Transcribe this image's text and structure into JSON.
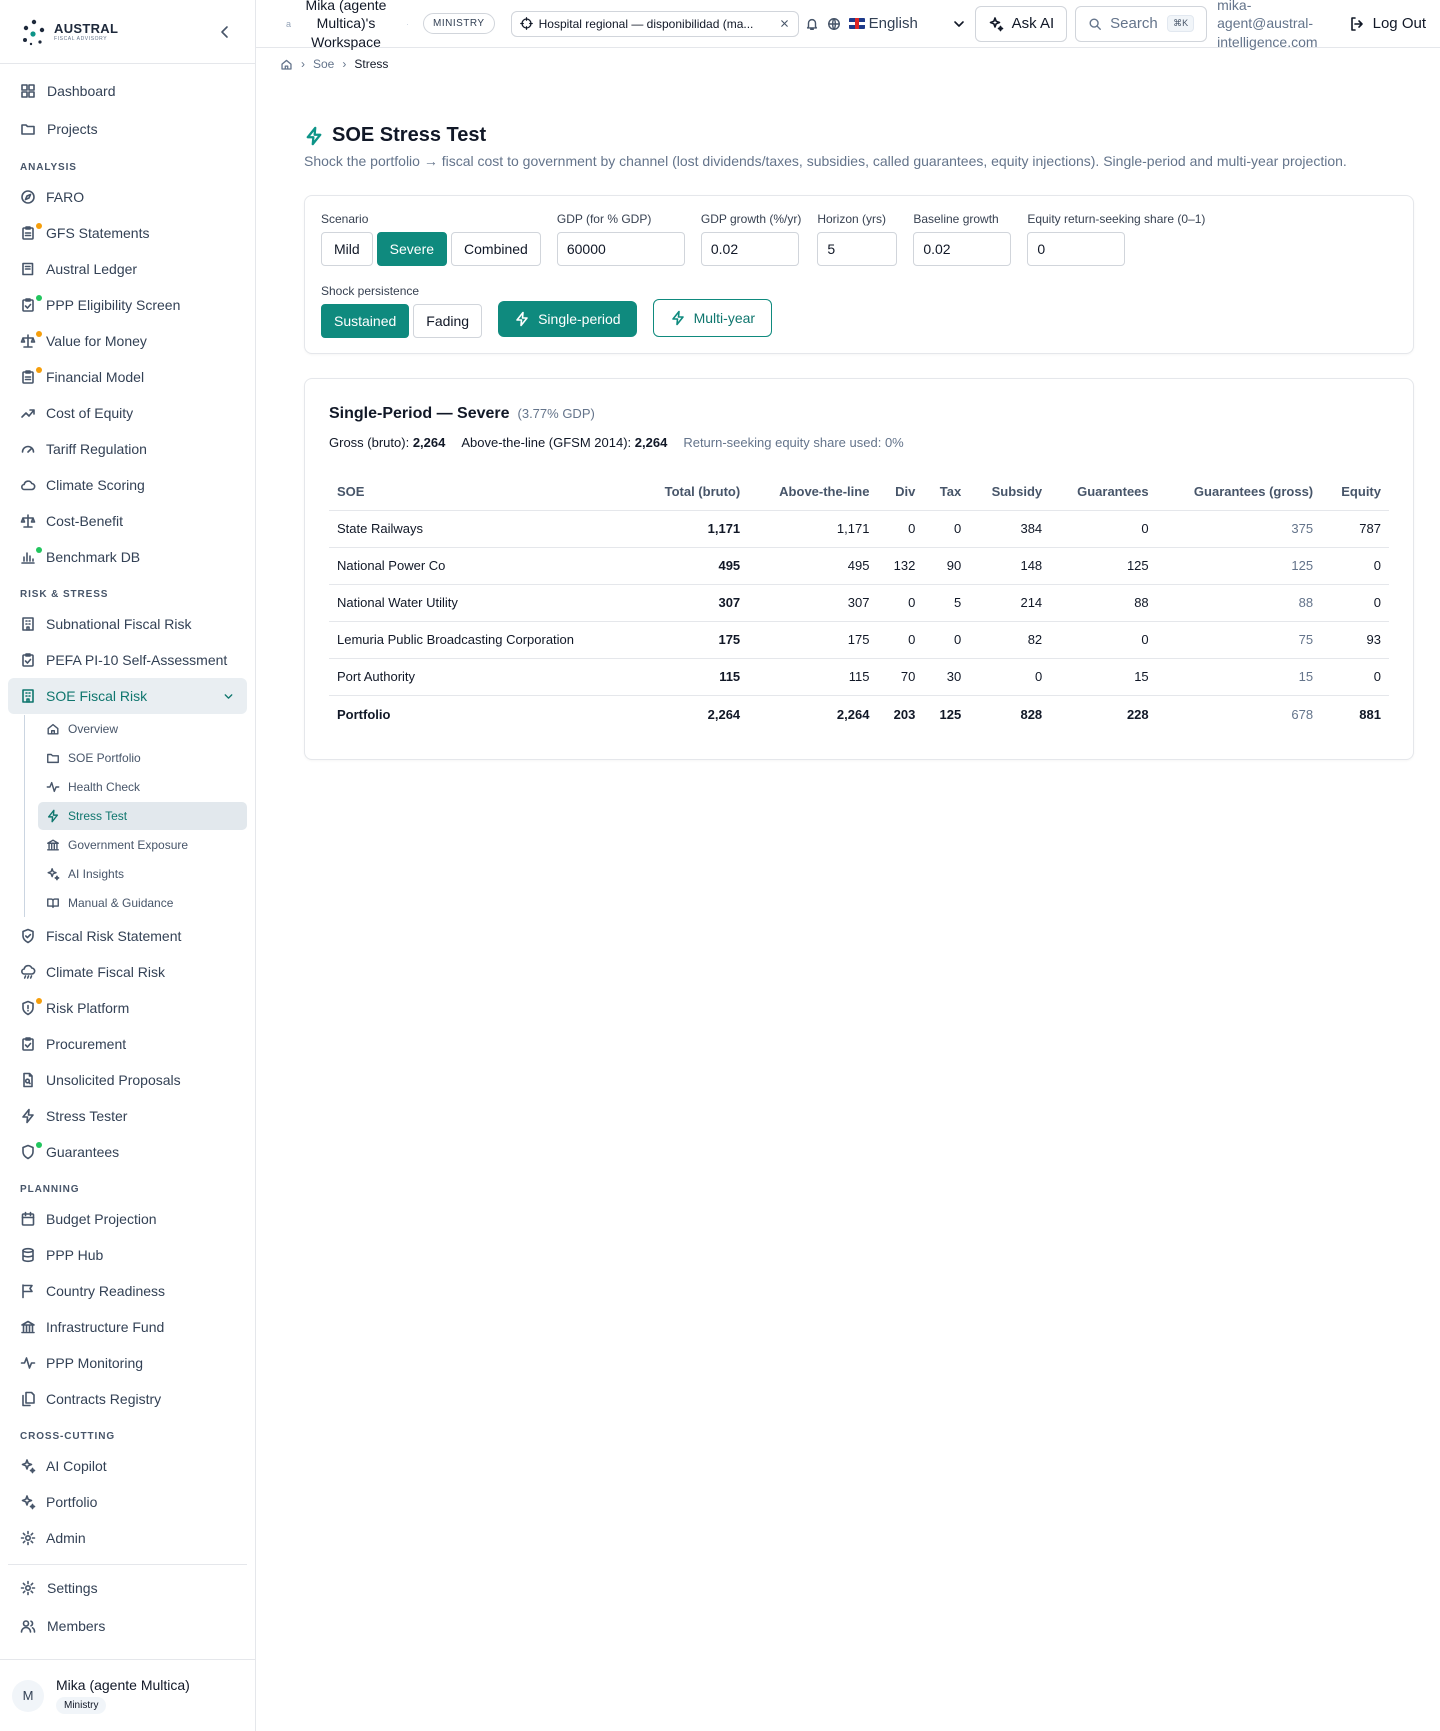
{
  "brand": {
    "name": "AUSTRAL",
    "sub": "FISCAL ADVISORY"
  },
  "colors": {
    "accent": "#0f8a7e",
    "dot_orange": "#f59e0b",
    "dot_green": "#22c55e"
  },
  "sidebar": {
    "top_items": [
      {
        "label": "Dashboard",
        "icon": "grid-icon"
      },
      {
        "label": "Projects",
        "icon": "folder-icon"
      }
    ],
    "sections": [
      {
        "title": "ANALYSIS",
        "items": [
          {
            "label": "FARO",
            "icon": "compass-icon"
          },
          {
            "label": "GFS Statements",
            "icon": "clipboard-icon",
            "dot": "orange"
          },
          {
            "label": "Austral Ledger",
            "icon": "book-icon"
          },
          {
            "label": "PPP Eligibility Screen",
            "icon": "clipboard-check-icon",
            "dot": "green"
          },
          {
            "label": "Value for Money",
            "icon": "scale-icon",
            "dot": "orange"
          },
          {
            "label": "Financial Model",
            "icon": "clipboard-icon",
            "dot": "orange"
          },
          {
            "label": "Cost of Equity",
            "icon": "trending-up-icon"
          },
          {
            "label": "Tariff Regulation",
            "icon": "gauge-icon"
          },
          {
            "label": "Climate Scoring",
            "icon": "cloud-icon"
          },
          {
            "label": "Cost-Benefit",
            "icon": "scale-icon"
          },
          {
            "label": "Benchmark DB",
            "icon": "bar-chart-icon",
            "dot": "green"
          }
        ]
      },
      {
        "title": "RISK & STRESS",
        "items": [
          {
            "label": "Subnational Fiscal Risk",
            "icon": "building-icon"
          },
          {
            "label": "PEFA PI-10 Self-Assessment",
            "icon": "clipboard-check-icon"
          }
        ]
      }
    ],
    "active_parent": {
      "label": "SOE Fiscal Risk",
      "icon": "building-icon"
    },
    "subnav": [
      {
        "label": "Overview",
        "icon": "home-icon"
      },
      {
        "label": "SOE Portfolio",
        "icon": "folder-icon"
      },
      {
        "label": "Health Check",
        "icon": "activity-icon"
      },
      {
        "label": "Stress Test",
        "icon": "zap-icon",
        "active": true
      },
      {
        "label": "Government Exposure",
        "icon": "landmark-icon"
      },
      {
        "label": "AI Insights",
        "icon": "sparkles-icon"
      },
      {
        "label": "Manual & Guidance",
        "icon": "book-open-icon"
      }
    ],
    "after_items": [
      {
        "label": "Fiscal Risk Statement",
        "icon": "shield-check-icon"
      },
      {
        "label": "Climate Fiscal Risk",
        "icon": "cloud-rain-icon"
      },
      {
        "label": "Risk Platform",
        "icon": "shield-alert-icon",
        "dot": "orange"
      },
      {
        "label": "Procurement",
        "icon": "clipboard-check-icon"
      },
      {
        "label": "Unsolicited Proposals",
        "icon": "file-search-icon"
      },
      {
        "label": "Stress Tester",
        "icon": "zap-icon"
      },
      {
        "label": "Guarantees",
        "icon": "shield-icon",
        "dot": "green"
      }
    ],
    "planning": {
      "title": "PLANNING",
      "items": [
        {
          "label": "Budget Projection",
          "icon": "calendar-icon"
        },
        {
          "label": "PPP Hub",
          "icon": "database-icon"
        },
        {
          "label": "Country Readiness",
          "icon": "flag-icon"
        },
        {
          "label": "Infrastructure Fund",
          "icon": "landmark-icon"
        },
        {
          "label": "PPP Monitoring",
          "icon": "activity-icon"
        },
        {
          "label": "Contracts Registry",
          "icon": "files-icon"
        }
      ]
    },
    "cross": {
      "title": "CROSS-CUTTING",
      "items": [
        {
          "label": "AI Copilot",
          "icon": "sparkles-icon"
        },
        {
          "label": "Portfolio",
          "icon": "sparkles-icon"
        },
        {
          "label": "Admin",
          "icon": "gear-icon"
        }
      ]
    },
    "bottom_items": [
      {
        "label": "Settings",
        "icon": "gear-icon"
      },
      {
        "label": "Members",
        "icon": "users-icon"
      }
    ],
    "user": {
      "initial": "M",
      "name": "Mika (agente Multica)",
      "role": "Ministry"
    }
  },
  "header": {
    "ws_prefix": "a",
    "workspace": "Mika (agente Multica)'s Workspace",
    "sep": "·",
    "badge": "MINISTRY",
    "context": "Hospital regional — disponibilidad (ma...",
    "language": "English",
    "ask_ai": "Ask AI",
    "search": "Search",
    "shortcut": "⌘K",
    "email": "mika-agent@austral-intelligence.com",
    "logout": "Log Out"
  },
  "breadcrumb": [
    "Soe",
    "Stress"
  ],
  "page": {
    "title": "SOE Stress Test",
    "description": "Shock the portfolio → fiscal cost to government by channel (lost dividends/taxes, subsidies, called guarantees, equity injections). Single-period and multi-year projection."
  },
  "controls": {
    "scenario_label": "Scenario",
    "scenarios": [
      "Mild",
      "Severe",
      "Combined"
    ],
    "scenario_selected": "Severe",
    "fields": [
      {
        "label": "GDP (for % GDP)",
        "value": "60000"
      },
      {
        "label": "GDP growth (%/yr)",
        "value": "0.02"
      },
      {
        "label": "Horizon (yrs)",
        "value": "5"
      },
      {
        "label": "Baseline growth",
        "value": "0.02"
      },
      {
        "label": "Equity return-seeking share (0–1)",
        "value": "0"
      }
    ],
    "persistence_label": "Shock persistence",
    "persistence": [
      "Sustained",
      "Fading"
    ],
    "persistence_selected": "Sustained",
    "single_period": "Single-period",
    "multi_year": "Multi-year"
  },
  "results": {
    "title": "Single-Period — Severe",
    "gdp_pct": "(3.77% GDP)",
    "gross_label": "Gross (bruto):",
    "gross_value": "2,264",
    "atl_label": "Above-the-line (GFSM 2014):",
    "atl_value": "2,264",
    "equity_share": "Return-seeking equity share used: 0%",
    "columns": [
      "SOE",
      "Total (bruto)",
      "Above-the-line",
      "Div",
      "Tax",
      "Subsidy",
      "Guarantees",
      "Guarantees (gross)",
      "Equity"
    ],
    "rows": [
      [
        "State Railways",
        "1,171",
        "1,171",
        "0",
        "0",
        "384",
        "0",
        "375",
        "787"
      ],
      [
        "National Power Co",
        "495",
        "495",
        "132",
        "90",
        "148",
        "125",
        "125",
        "0"
      ],
      [
        "National Water Utility",
        "307",
        "307",
        "0",
        "5",
        "214",
        "88",
        "88",
        "0"
      ],
      [
        "Lemuria Public Broadcasting Corporation",
        "175",
        "175",
        "0",
        "0",
        "82",
        "0",
        "75",
        "93"
      ],
      [
        "Port Authority",
        "115",
        "115",
        "70",
        "30",
        "0",
        "15",
        "15",
        "0"
      ]
    ],
    "total": [
      "Portfolio",
      "2,264",
      "2,264",
      "203",
      "125",
      "828",
      "228",
      "678",
      "881"
    ]
  }
}
